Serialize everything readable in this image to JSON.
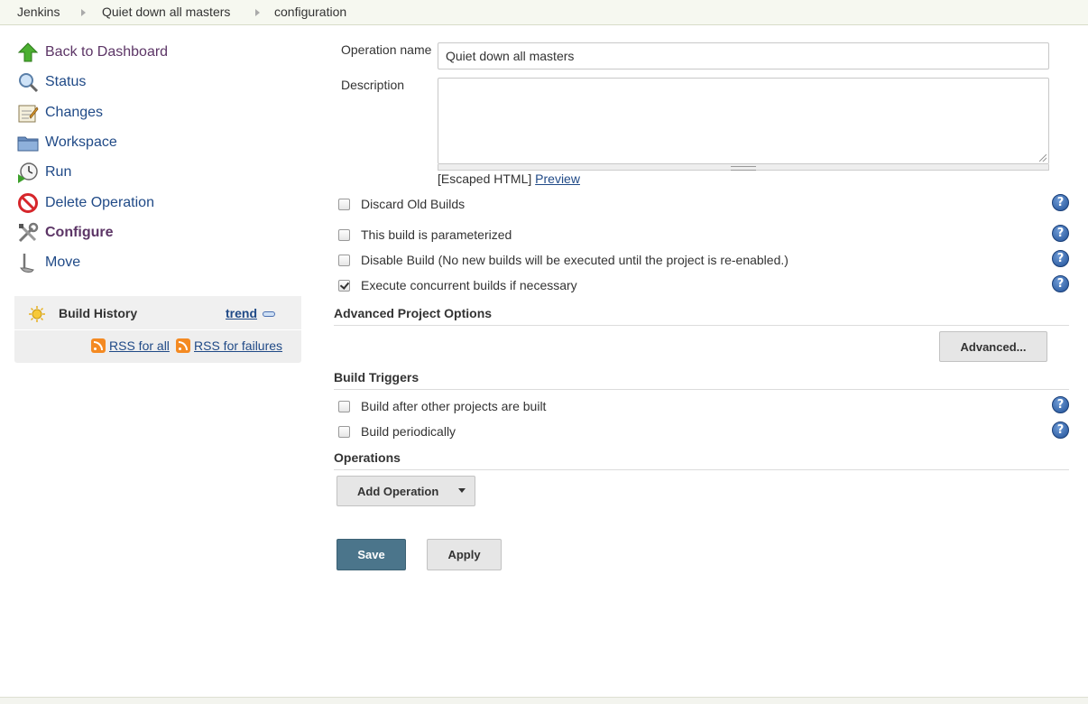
{
  "breadcrumb": [
    "Jenkins",
    "Quiet down all masters",
    "configuration"
  ],
  "sidebar": {
    "items": [
      {
        "label": "Back to Dashboard",
        "icon": "up-arrow-icon"
      },
      {
        "label": "Status",
        "icon": "search-icon"
      },
      {
        "label": "Changes",
        "icon": "notepad-icon"
      },
      {
        "label": "Workspace",
        "icon": "folder-icon"
      },
      {
        "label": "Run",
        "icon": "clock-icon"
      },
      {
        "label": "Delete Operation",
        "icon": "no-entry-icon"
      },
      {
        "label": "Configure",
        "icon": "tools-icon"
      },
      {
        "label": "Move",
        "icon": "move-icon"
      }
    ],
    "build_history": {
      "title": "Build History",
      "trend": "trend",
      "rss_all": "RSS for all",
      "rss_failures": "RSS for failures"
    }
  },
  "form": {
    "operation_name_label": "Operation name",
    "operation_name_value": "Quiet down all masters",
    "description_label": "Description",
    "escaped_html": "[Escaped HTML]",
    "preview": "Preview",
    "options": [
      {
        "label": "Discard Old Builds",
        "checked": false
      },
      {
        "label": "This build is parameterized",
        "checked": false
      },
      {
        "label": "Disable Build (No new builds will be executed until the project is re-enabled.)",
        "checked": false
      },
      {
        "label": "Execute concurrent builds if necessary",
        "checked": true
      }
    ],
    "advanced_section": "Advanced Project Options",
    "advanced_button": "Advanced...",
    "triggers_section": "Build Triggers",
    "triggers": [
      {
        "label": "Build after other projects are built",
        "checked": false
      },
      {
        "label": "Build periodically",
        "checked": false
      }
    ],
    "operations_section": "Operations",
    "add_operation": "Add Operation",
    "save": "Save",
    "apply": "Apply"
  },
  "colors": {
    "link": "#204a87",
    "visited": "#5c3566",
    "primary_button": "#4b758b",
    "rss": "#f48a22"
  }
}
